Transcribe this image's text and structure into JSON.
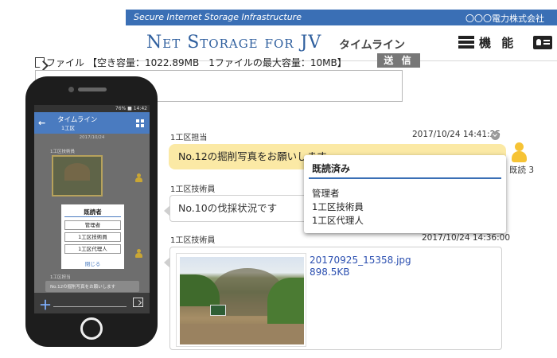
{
  "header": {
    "tagline": "Secure Internet Storage Infrastructure",
    "company": "〇〇〇電力株式会社",
    "brand": "Net Storage for JV",
    "page_title": "タイムライン",
    "menu_label": "機 能",
    "icons": {
      "menu": "list-menu-icon",
      "profile": "id-card-icon"
    }
  },
  "toolbar": {
    "file_label": "ファイル",
    "capacity": "【空き容量：1022.89MB　1ファイルの最大容量：10MB】",
    "send_label": "送 信"
  },
  "compose": {
    "value": ""
  },
  "timeline": {
    "posts": [
      {
        "author": "1工区担当",
        "timestamp": "2017/10/24 14:41:25",
        "message": "No.12の掘削写真をお願いします",
        "read_label": "既読 3"
      },
      {
        "author": "1工区技術員",
        "message": "No.10の伐採状況です"
      },
      {
        "author": "1工区技術員",
        "timestamp": "2017/10/24 14:36:00",
        "attachment": {
          "name": "20170925_15358.jpg",
          "size": "898.5KB"
        }
      }
    ]
  },
  "read_popup": {
    "title": "既読済み",
    "readers": [
      "管理者",
      "1工区技術員",
      "1工区代理人"
    ]
  },
  "mobile": {
    "status": "76% ■ 14:42",
    "title": "タイムライン",
    "subtitle": "1工区",
    "date": "2017/10/24",
    "post1_author": "1工区技術員",
    "post2_author": "1工区担当",
    "post2_message": "No.12の掘削写真をお願いします",
    "dialog": {
      "title": "既読者",
      "readers": [
        "管理者",
        "1工区技術員",
        "1工区代理人"
      ],
      "close": "閉じる"
    },
    "icons": {
      "back": "back-arrow-icon",
      "grid": "grid-icon",
      "add": "plus-icon",
      "send": "send-icon"
    },
    "back_glyph": "←",
    "add_glyph": "＋"
  },
  "colors": {
    "brand_blue": "#3a6fb5",
    "bubble_yellow": "#fbe9a5",
    "reader_icon": "#f6c335"
  }
}
